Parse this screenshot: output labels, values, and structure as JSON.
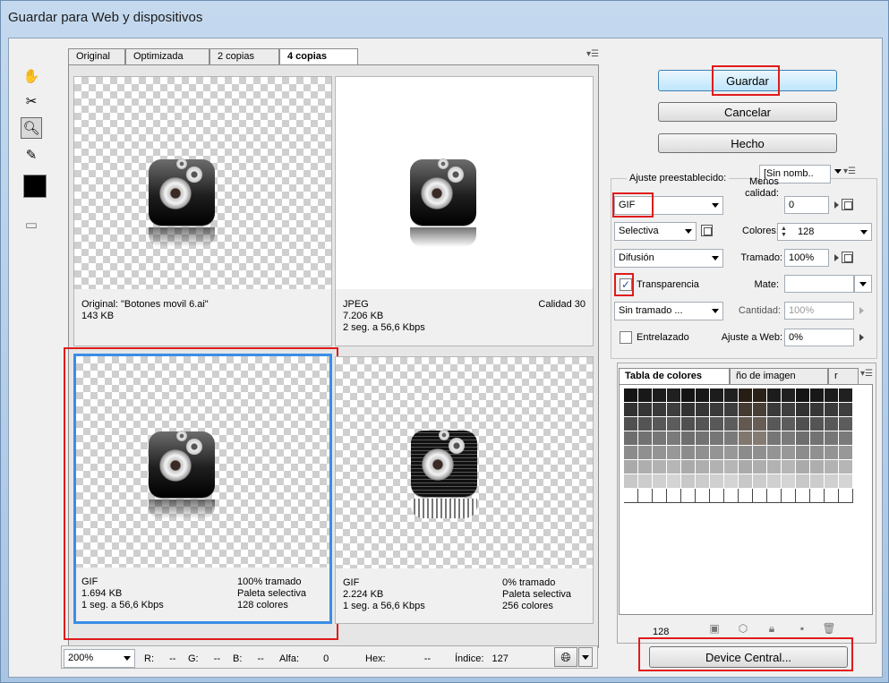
{
  "window": {
    "title": "Guardar para Web y dispositivos"
  },
  "tabs": [
    {
      "label": "Original",
      "active": false
    },
    {
      "label": "Optimizada",
      "active": false
    },
    {
      "label": "2 copias",
      "active": false
    },
    {
      "label": "4 copias",
      "active": true
    }
  ],
  "panes": [
    {
      "format": "Original: \"Botones movil 6.ai\"",
      "size": "143 KB",
      "time": "",
      "right1": "",
      "right2": "",
      "right3": ""
    },
    {
      "format": "JPEG",
      "size": "7.206 KB",
      "time": "2 seg. a 56,6 Kbps",
      "right1": "Calidad 30",
      "right2": "",
      "right3": ""
    },
    {
      "format": "GIF",
      "size": "1.694 KB",
      "time": "1 seg. a 56,6 Kbps",
      "right1": "100% tramado",
      "right2": "Paleta selectiva",
      "right3": "128 colores"
    },
    {
      "format": "GIF",
      "size": "2.224 KB",
      "time": "1 seg. a 56,6 Kbps",
      "right1": "0% tramado",
      "right2": "Paleta selectiva",
      "right3": "256 colores"
    }
  ],
  "buttons": {
    "save": "Guardar",
    "cancel": "Cancelar",
    "done": "Hecho",
    "device_central": "Device Central..."
  },
  "settings": {
    "preset_label": "Ajuste preestablecido:",
    "preset_value": "[Sin nomb..",
    "format": "GIF",
    "quality_label_1": "Menos",
    "quality_label_2": "calidad:",
    "quality_value": "0",
    "palette": "Selectiva",
    "colors_label": "Colores:",
    "colors_value": "128",
    "dither": "Difusión",
    "dither_label": "Tramado:",
    "dither_value": "100%",
    "transparency_label": "Transparencia",
    "transparency_checked": true,
    "matte_label": "Mate:",
    "matte_value": "",
    "trans_dither": "Sin tramado ...",
    "amount_label": "Cantidad:",
    "amount_value": "100%",
    "interlaced_label": "Entrelazado",
    "interlaced_checked": false,
    "web_snap_label": "Ajuste a Web:",
    "web_snap_value": "0%"
  },
  "color_panel": {
    "tabs": [
      "Tabla de colores",
      "ño de imagen",
      "r"
    ],
    "count": "128"
  },
  "status": {
    "zoom": "200%",
    "r_label": "R:",
    "r_value": "--",
    "g_label": "G:",
    "g_value": "--",
    "b_label": "B:",
    "b_value": "--",
    "alpha_label": "Alfa:",
    "alpha_value": "0",
    "hex_label": "Hex:",
    "hex_value": "--",
    "index_label": "Índice:",
    "index_value": "127"
  },
  "colors": {
    "highlight": "#e01b1b",
    "selection": "#3a8ee6",
    "primary_button": "#bee6fd"
  }
}
